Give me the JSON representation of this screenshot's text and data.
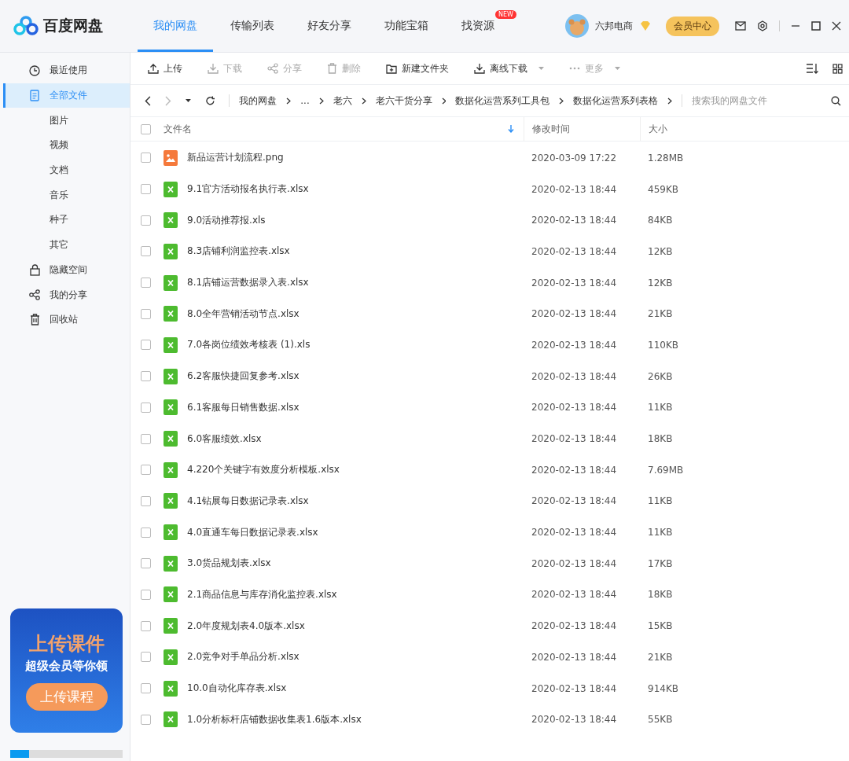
{
  "app": {
    "name": "百度网盘"
  },
  "nav_tabs": [
    {
      "label": "我的网盘",
      "selected": true
    },
    {
      "label": "传输列表",
      "selected": false
    },
    {
      "label": "好友分享",
      "selected": false
    },
    {
      "label": "功能宝箱",
      "selected": false
    },
    {
      "label": "找资源",
      "selected": false,
      "badge": "NEW"
    }
  ],
  "user": {
    "name": "六邦电商",
    "vip_button": "会员中心"
  },
  "sidebar": {
    "items": [
      {
        "label": "最近使用",
        "kind": "clock",
        "selected": false
      },
      {
        "label": "全部文件",
        "kind": "doc",
        "selected": true
      },
      {
        "label": "图片",
        "selected": false
      },
      {
        "label": "视频",
        "selected": false
      },
      {
        "label": "文档",
        "selected": false
      },
      {
        "label": "音乐",
        "selected": false
      },
      {
        "label": "种子",
        "selected": false
      },
      {
        "label": "其它",
        "selected": false
      },
      {
        "label": "隐藏空间",
        "kind": "lock",
        "selected": false
      },
      {
        "label": "我的分享",
        "kind": "share",
        "selected": false
      },
      {
        "label": "回收站",
        "kind": "trash",
        "selected": false
      }
    ],
    "promo": {
      "title": "上传课件",
      "subtitle": "超级会员等你领",
      "button": "上传课程"
    },
    "storage": {
      "level": 0.17
    }
  },
  "toolbar": [
    {
      "label": "上传",
      "kind": "upload",
      "disabled": false
    },
    {
      "label": "下载",
      "kind": "download",
      "disabled": true
    },
    {
      "label": "分享",
      "kind": "share",
      "disabled": true
    },
    {
      "label": "删除",
      "kind": "trash",
      "disabled": true
    },
    {
      "label": "新建文件夹",
      "kind": "folder",
      "disabled": false
    },
    {
      "label": "离线下载",
      "kind": "download",
      "disabled": false,
      "dropdown": true
    },
    {
      "label": "更多",
      "kind": "dots",
      "disabled": true,
      "dropdown": true
    }
  ],
  "breadcrumb": [
    "我的网盘",
    "...",
    "老六",
    "老六干货分享",
    "数据化运营系列工具包",
    "数据化运营系列表格"
  ],
  "search": {
    "placeholder": "搜索我的网盘文件"
  },
  "table": {
    "columns": [
      "文件名",
      "修改时间",
      "大小"
    ],
    "all_checked": false,
    "rows": [
      {
        "name": "新品运营计划流程.png",
        "kind": "image",
        "modified": "2020-03-09 17:22",
        "size": "1.28MB",
        "checked": false
      },
      {
        "name": "9.1官方活动报名执行表.xlsx",
        "kind": "excel",
        "modified": "2020-02-13 18:44",
        "size": "459KB",
        "checked": false
      },
      {
        "name": "9.0活动推荐报.xls",
        "kind": "excel",
        "modified": "2020-02-13 18:44",
        "size": "84KB",
        "checked": false
      },
      {
        "name": "8.3店铺利润监控表.xlsx",
        "kind": "excel",
        "modified": "2020-02-13 18:44",
        "size": "12KB",
        "checked": false
      },
      {
        "name": "8.1店铺运营数据录入表.xlsx",
        "kind": "excel",
        "modified": "2020-02-13 18:44",
        "size": "12KB",
        "checked": false
      },
      {
        "name": "8.0全年营销活动节点.xlsx",
        "kind": "excel",
        "modified": "2020-02-13 18:44",
        "size": "21KB",
        "checked": false
      },
      {
        "name": "7.0各岗位绩效考核表 (1).xls",
        "kind": "excel",
        "modified": "2020-02-13 18:44",
        "size": "110KB",
        "checked": false
      },
      {
        "name": "6.2客服快捷回复参考.xlsx",
        "kind": "excel",
        "modified": "2020-02-13 18:44",
        "size": "26KB",
        "checked": false
      },
      {
        "name": "6.1客服每日销售数据.xlsx",
        "kind": "excel",
        "modified": "2020-02-13 18:44",
        "size": "11KB",
        "checked": false
      },
      {
        "name": "6.0客服绩效.xlsx",
        "kind": "excel",
        "modified": "2020-02-13 18:44",
        "size": "18KB",
        "checked": false
      },
      {
        "name": "4.220个关键字有效度分析模板.xlsx",
        "kind": "excel",
        "modified": "2020-02-13 18:44",
        "size": "7.69MB",
        "checked": false
      },
      {
        "name": "4.1钻展每日数据记录表.xlsx",
        "kind": "excel",
        "modified": "2020-02-13 18:44",
        "size": "11KB",
        "checked": false
      },
      {
        "name": "4.0直通车每日数据记录表.xlsx",
        "kind": "excel",
        "modified": "2020-02-13 18:44",
        "size": "11KB",
        "checked": false
      },
      {
        "name": "3.0货品规划表.xlsx",
        "kind": "excel",
        "modified": "2020-02-13 18:44",
        "size": "17KB",
        "checked": false
      },
      {
        "name": "2.1商品信息与库存消化监控表.xlsx",
        "kind": "excel",
        "modified": "2020-02-13 18:44",
        "size": "18KB",
        "checked": false
      },
      {
        "name": "2.0年度规划表4.0版本.xlsx",
        "kind": "excel",
        "modified": "2020-02-13 18:44",
        "size": "15KB",
        "checked": false
      },
      {
        "name": "2.0竞争对手单品分析.xlsx",
        "kind": "excel",
        "modified": "2020-02-13 18:44",
        "size": "21KB",
        "checked": false
      },
      {
        "name": "10.0自动化库存表.xlsx",
        "kind": "excel",
        "modified": "2020-02-13 18:44",
        "size": "914KB",
        "checked": false
      },
      {
        "name": "1.0分析标杆店铺数据收集表1.6版本.xlsx",
        "kind": "excel",
        "modified": "2020-02-13 18:44",
        "size": "55KB",
        "checked": false
      }
    ]
  }
}
